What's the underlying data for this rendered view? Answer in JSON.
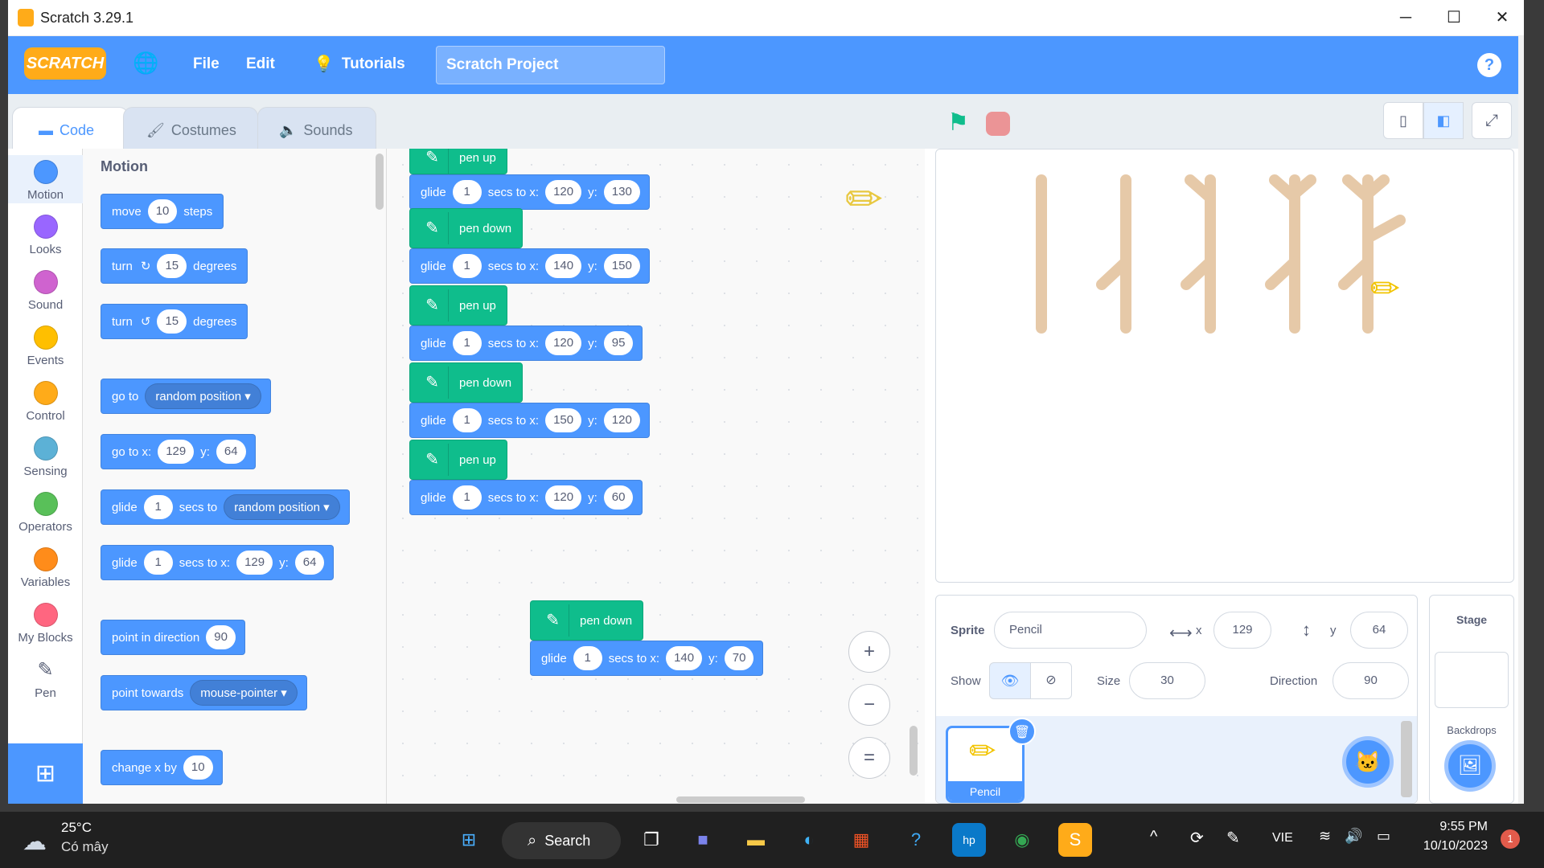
{
  "window": {
    "title": "Scratch 3.29.1",
    "minimize": "─",
    "maximize": "☐",
    "close": "✕"
  },
  "menubar": {
    "logo": "SCRATCH",
    "globe": "🌐",
    "file": "File",
    "edit": "Edit",
    "tutorials": "Tutorials",
    "project_title": "Scratch Project",
    "help": "?"
  },
  "tabs": {
    "code": "Code",
    "costumes": "Costumes",
    "sounds": "Sounds"
  },
  "categories": [
    {
      "label": "Motion",
      "color": "#4c97ff"
    },
    {
      "label": "Looks",
      "color": "#9966ff"
    },
    {
      "label": "Sound",
      "color": "#cf63cf"
    },
    {
      "label": "Events",
      "color": "#ffbf00"
    },
    {
      "label": "Control",
      "color": "#ffab19"
    },
    {
      "label": "Sensing",
      "color": "#5cb1d6"
    },
    {
      "label": "Operators",
      "color": "#59c059"
    },
    {
      "label": "Variables",
      "color": "#ff8c1a"
    },
    {
      "label": "My Blocks",
      "color": "#ff6680"
    },
    {
      "label": "Pen",
      "color": "#0fbd8c"
    }
  ],
  "palette": {
    "heading": "Motion",
    "move": {
      "a": "move",
      "v": "10",
      "b": "steps"
    },
    "turn_right": {
      "a": "turn",
      "icon": "↻",
      "v": "15",
      "b": "degrees"
    },
    "turn_left": {
      "a": "turn",
      "icon": "↺",
      "v": "15",
      "b": "degrees"
    },
    "goto": {
      "a": "go to",
      "drop": "random position ▾"
    },
    "gotoxy": {
      "a": "go to x:",
      "x": "129",
      "b": "y:",
      "y": "64"
    },
    "glide_to": {
      "a": "glide",
      "v": "1",
      "b": "secs to",
      "drop": "random position ▾"
    },
    "glide_xy": {
      "a": "glide",
      "v": "1",
      "b": "secs to x:",
      "x": "129",
      "c": "y:",
      "y": "64"
    },
    "point_dir": {
      "a": "point in direction",
      "v": "90"
    },
    "point_towards": {
      "a": "point towards",
      "drop": "mouse-pointer ▾"
    },
    "change_x": {
      "a": "change x by",
      "v": "10"
    }
  },
  "script": {
    "pen_up": "pen up",
    "pen_down": "pen down",
    "glide": "glide",
    "secs_to_x": "secs to x:",
    "y": "y:",
    "glides": [
      {
        "s": "1",
        "x": "120",
        "y": "130"
      },
      {
        "s": "1",
        "x": "140",
        "y": "150"
      },
      {
        "s": "1",
        "x": "120",
        "y": "95"
      },
      {
        "s": "1",
        "x": "150",
        "y": "120"
      },
      {
        "s": "1",
        "x": "120",
        "y": "60"
      }
    ],
    "glide2": {
      "s": "1",
      "x": "140",
      "y": "70"
    }
  },
  "zoom": {
    "in": "+",
    "out": "−",
    "reset": "="
  },
  "sprite_info": {
    "sprite_label": "Sprite",
    "sprite_name": "Pencil",
    "x_label": "x",
    "x": "129",
    "y_label": "y",
    "y": "64",
    "show_label": "Show",
    "size_label": "Size",
    "size": "30",
    "direction_label": "Direction",
    "direction": "90",
    "sprite_thumb_name": "Pencil"
  },
  "stage_pane": {
    "title": "Stage",
    "backdrops": "Backdrops"
  },
  "taskbar": {
    "temp": "25°C",
    "weather": "Có mây",
    "search": "Search",
    "lang": "VIE",
    "time": "9:55 PM",
    "date": "10/10/2023",
    "notif": "1"
  }
}
